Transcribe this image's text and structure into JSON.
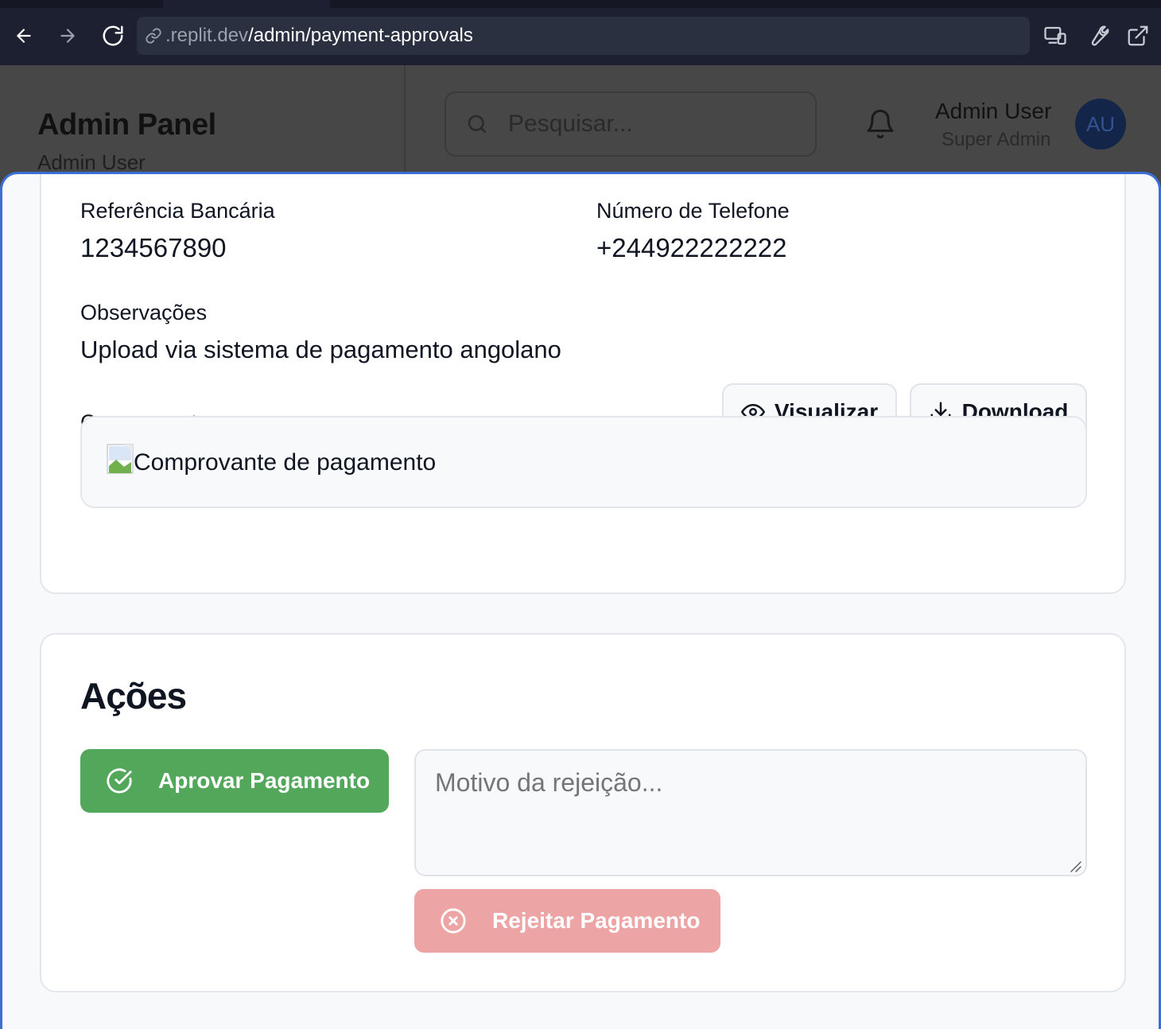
{
  "browser": {
    "url_prefix": ".replit.dev",
    "url_path": "/admin/payment-approvals"
  },
  "app": {
    "title": "Admin Panel",
    "subtitle": "Admin User",
    "search_placeholder": "Pesquisar...",
    "user_name": "Admin User",
    "user_role": "Super Admin",
    "avatar_initials": "AU"
  },
  "details": {
    "bank_ref_label": "Referência Bancária",
    "bank_ref_value": "1234567890",
    "phone_label": "Número de Telefone",
    "phone_value": "+244922222222",
    "notes_label": "Observações",
    "notes_value": "Upload via sistema de pagamento angolano",
    "proof_label": "Comprovante",
    "view_button": "Visualizar",
    "download_button": "Download",
    "proof_alt": "Comprovante de pagamento"
  },
  "actions": {
    "title": "Ações",
    "approve_button": "Aprovar Pagamento",
    "reason_placeholder": "Motivo da rejeição...",
    "reject_button": "Rejeitar Pagamento"
  },
  "colors": {
    "approve": "#52a75a",
    "reject": "#eda4a4",
    "modal_border": "#3b6fd6"
  }
}
